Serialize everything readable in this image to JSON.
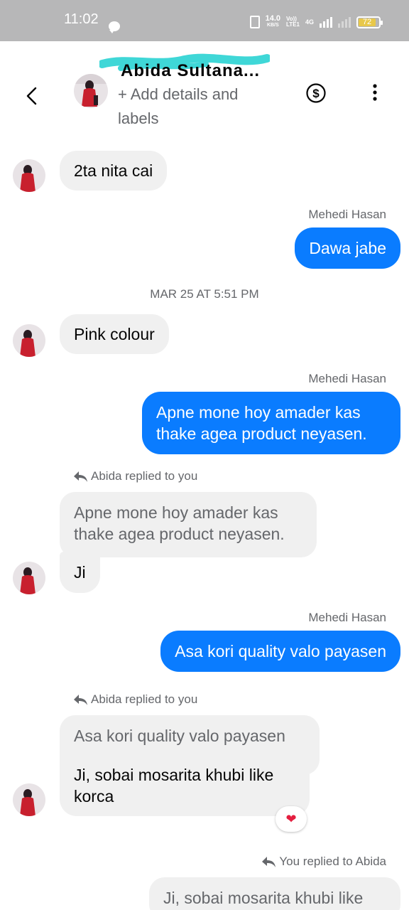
{
  "status_bar": {
    "time": "11:02",
    "speed_value": "14.0",
    "speed_unit": "KB/S",
    "volte_top": "Vo))",
    "volte_bottom": "LTE1",
    "network": "4G",
    "battery": "72"
  },
  "header": {
    "contact_name": "Abida Sultana...",
    "add_details": "+ Add details and labels"
  },
  "messages": {
    "m1": {
      "text": "2ta nita cai"
    },
    "m2": {
      "sender": "Mehedi Hasan",
      "text": "Dawa jabe"
    },
    "timestamp": "MAR 25 AT 5:51 PM",
    "m3": {
      "text": "Pink colour"
    },
    "m4": {
      "sender": "Mehedi Hasan",
      "text": "Apne mone hoy amader kas thake agea product neyasen."
    },
    "m5": {
      "reply_label": "Abida replied to you",
      "quote": "Apne mone hoy amader kas thake agea product neyasen.",
      "text": "Ji"
    },
    "m6": {
      "sender": "Mehedi Hasan",
      "text": "Asa kori quality valo payasen"
    },
    "m7": {
      "reply_label": "Abida replied to you",
      "quote": "Asa kori quality valo payasen",
      "text": "Ji, sobai mosarita khubi like korca",
      "reaction": "❤"
    },
    "m8": {
      "reply_label": "You replied to Abida",
      "quote": "Ji, sobai mosarita khubi like"
    }
  },
  "colors": {
    "outgoing_bubble": "#0a7cff",
    "incoming_bubble": "#f0f0f0",
    "status_bar": "#b7b7b8",
    "reaction_heart": "#e41e3f"
  },
  "icons": [
    "back-arrow-icon",
    "dollar-icon",
    "more-vertical-icon",
    "reply-arrow-icon",
    "heart-icon"
  ]
}
